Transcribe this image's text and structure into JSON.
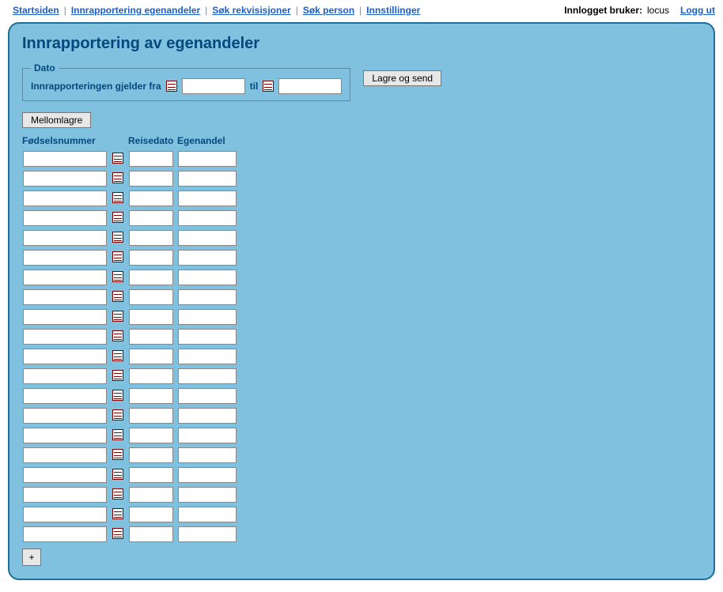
{
  "nav": {
    "items": [
      {
        "label": "Startsiden"
      },
      {
        "label": "Innrapportering egenandeler"
      },
      {
        "label": "Søk rekvisisjoner"
      },
      {
        "label": "Søk person"
      },
      {
        "label": "Innstillinger"
      }
    ],
    "user_label": "Innlogget bruker:",
    "user_name": "locus",
    "logout": "Logg ut"
  },
  "panel": {
    "title": "Innrapportering av egenandeler",
    "date_legend": "Dato",
    "from_label": "Innrapporteringen gjelder fra",
    "to_label": "til",
    "from_value": "",
    "to_value": "",
    "save_send": "Lagre og send",
    "mellomlagre": "Mellomlagre",
    "headers": {
      "fnr": "Fødselsnummer",
      "reisedato": "Reisedato",
      "egenandel": "Egenandel"
    },
    "add_label": "+",
    "row_count": 20
  }
}
